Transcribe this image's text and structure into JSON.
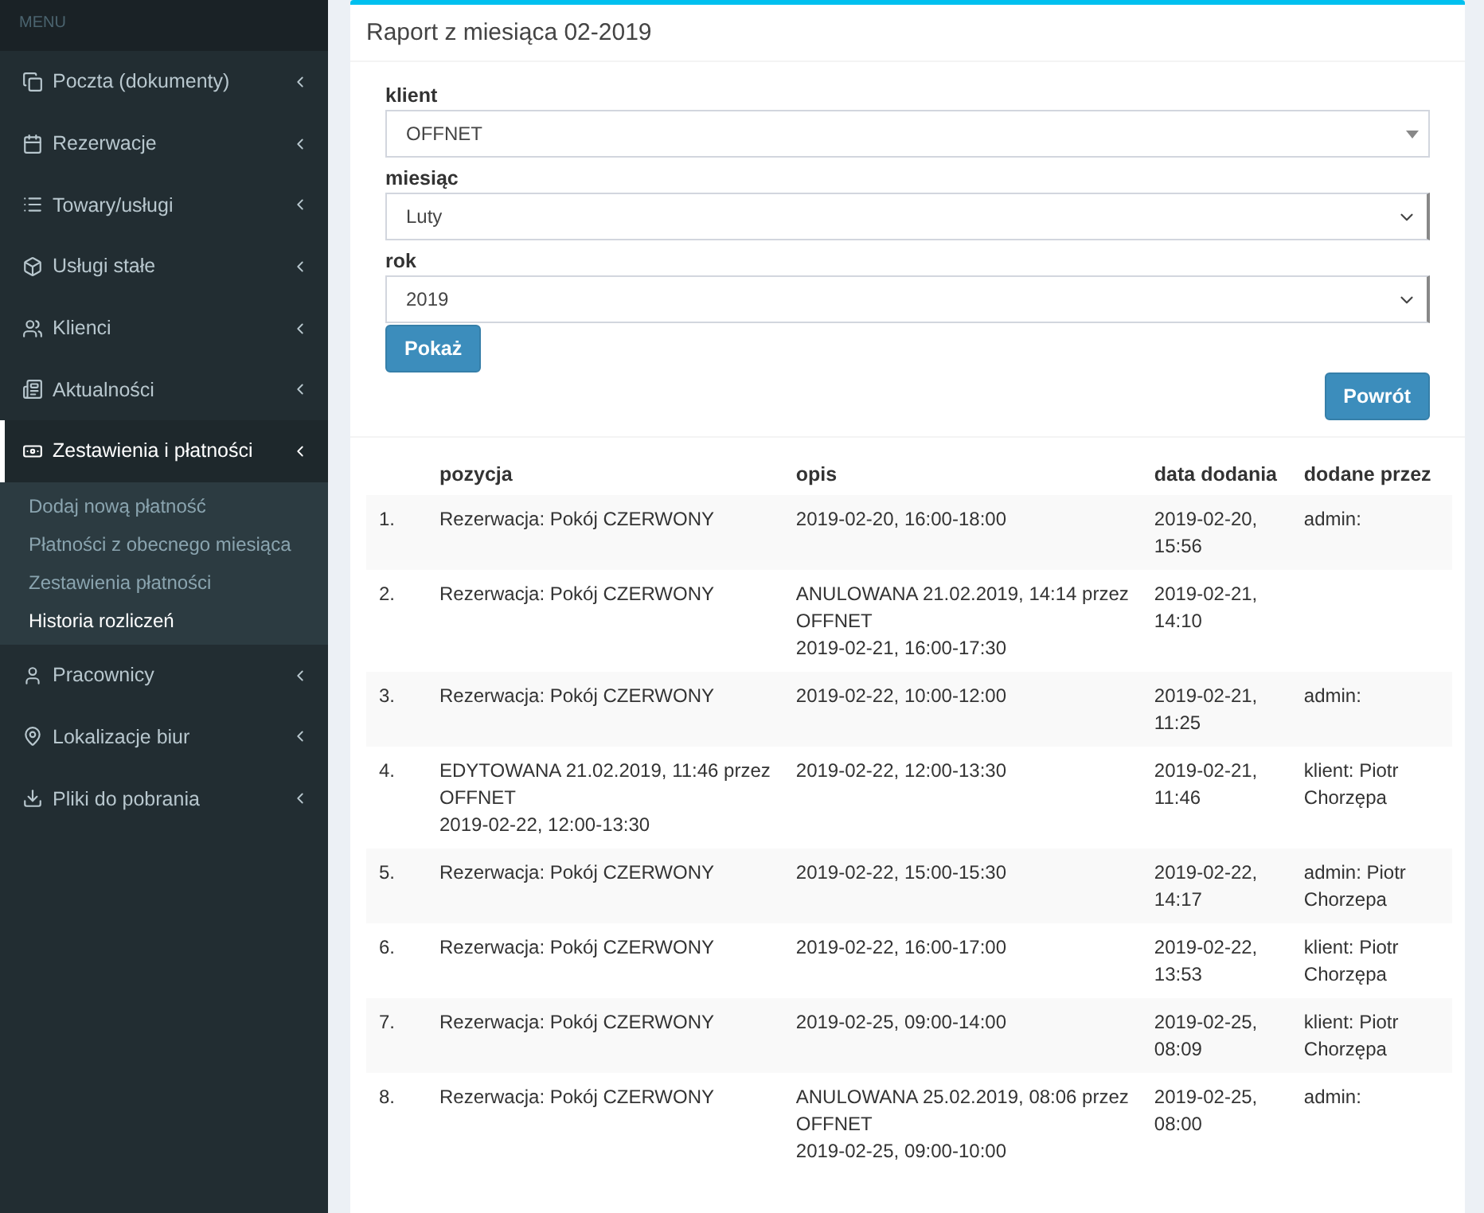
{
  "sidebar": {
    "header": "MENU",
    "items": [
      {
        "label": "Poczta (dokumenty)",
        "selected": false
      },
      {
        "label": "Rezerwacje",
        "selected": false
      },
      {
        "label": "Towary/usługi",
        "selected": false
      },
      {
        "label": "Usługi stałe",
        "selected": false
      },
      {
        "label": "Klienci",
        "selected": false
      },
      {
        "label": "Aktualności",
        "selected": false
      },
      {
        "label": "Zestawienia i płatności",
        "selected": true,
        "children": [
          {
            "label": "Dodaj nową płatność",
            "selected": false
          },
          {
            "label": "Płatności z obecnego miesiąca",
            "selected": false
          },
          {
            "label": "Zestawienia płatności",
            "selected": false
          },
          {
            "label": "Historia rozliczeń",
            "selected": true
          }
        ]
      },
      {
        "label": "Pracownicy",
        "selected": false
      },
      {
        "label": "Lokalizacje biur",
        "selected": false
      },
      {
        "label": "Pliki do pobrania",
        "selected": false
      }
    ]
  },
  "box": {
    "title": "Raport z miesiąca 02-2019",
    "fields": [
      {
        "label": "klient",
        "value": "OFFNET",
        "kind": "combo"
      },
      {
        "label": "miesiąc",
        "value": "Luty",
        "kind": "select"
      },
      {
        "label": "rok",
        "value": "2019",
        "kind": "select"
      }
    ],
    "show_button": "Pokaż",
    "back_button": "Powrót",
    "table": {
      "columns": [
        "pozycja",
        "opis",
        "data dodania",
        "dodane przez"
      ],
      "rows": [
        {
          "number": "1.",
          "pozycja": [
            "Rezerwacja: Pokój CZERWONY"
          ],
          "opis": [
            "2019-02-20, 16:00-18:00"
          ],
          "data": [
            "2019-02-20,",
            "15:56"
          ],
          "przez": [
            "admin:"
          ]
        },
        {
          "number": "2.",
          "pozycja": [
            "Rezerwacja: Pokój CZERWONY"
          ],
          "opis": [
            "ANULOWANA 21.02.2019, 14:14 przez",
            "OFFNET",
            "2019-02-21, 16:00-17:30"
          ],
          "data": [
            "2019-02-21,",
            "14:10"
          ],
          "przez": []
        },
        {
          "number": "3.",
          "pozycja": [
            "Rezerwacja: Pokój CZERWONY"
          ],
          "opis": [
            "2019-02-22, 10:00-12:00"
          ],
          "data": [
            "2019-02-21,",
            "11:25"
          ],
          "przez": [
            "admin:"
          ]
        },
        {
          "number": "4.",
          "pozycja": [
            "EDYTOWANA 21.02.2019, 11:46 przez",
            "OFFNET",
            "2019-02-22, 12:00-13:30"
          ],
          "opis": [
            "2019-02-22, 12:00-13:30"
          ],
          "data": [
            "2019-02-21,",
            "11:46"
          ],
          "przez": [
            "klient: Piotr",
            "Chorzępa"
          ]
        },
        {
          "number": "5.",
          "pozycja": [
            "Rezerwacja: Pokój CZERWONY"
          ],
          "opis": [
            "2019-02-22, 15:00-15:30"
          ],
          "data": [
            "2019-02-22,",
            "14:17"
          ],
          "przez": [
            "admin: Piotr",
            "Chorzepa"
          ]
        },
        {
          "number": "6.",
          "pozycja": [
            "Rezerwacja: Pokój CZERWONY"
          ],
          "opis": [
            "2019-02-22, 16:00-17:00"
          ],
          "data": [
            "2019-02-22,",
            "13:53"
          ],
          "przez": [
            "klient: Piotr",
            "Chorzępa"
          ]
        },
        {
          "number": "7.",
          "pozycja": [
            "Rezerwacja: Pokój CZERWONY"
          ],
          "opis": [
            "2019-02-25, 09:00-14:00"
          ],
          "data": [
            "2019-02-25,",
            "08:09"
          ],
          "przez": [
            "klient: Piotr",
            "Chorzępa"
          ]
        },
        {
          "number": "8.",
          "pozycja": [
            "Rezerwacja: Pokój CZERWONY"
          ],
          "opis": [
            "ANULOWANA 25.02.2019, 08:06 przez",
            "OFFNET",
            "2019-02-25, 09:00-10:00"
          ],
          "data": [
            "2019-02-25,",
            "08:00"
          ],
          "przez": [
            "admin:"
          ]
        }
      ]
    }
  }
}
